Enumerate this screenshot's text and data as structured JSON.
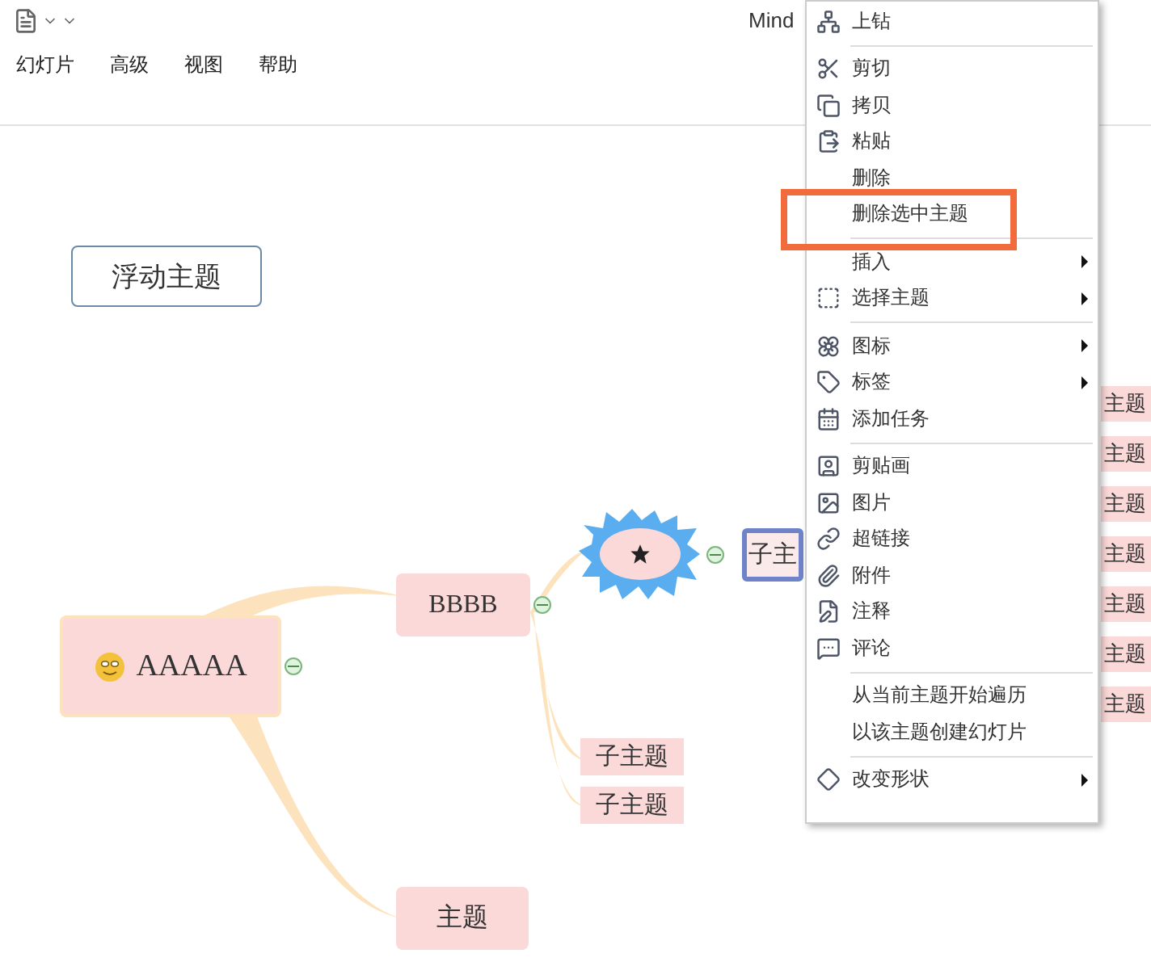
{
  "toolbar": {
    "title": "Mind",
    "ribbon_tabs": [
      "幻灯片",
      "高级",
      "视图",
      "帮助"
    ]
  },
  "canvas": {
    "floating_topic": {
      "text": "浮动主题"
    },
    "topics": [
      {
        "kind": "central",
        "text": "AAAAA",
        "selected": false
      },
      {
        "kind": "main",
        "text": "BBBB",
        "selected": false
      },
      {
        "kind": "main",
        "text": "主题",
        "selected": false
      },
      {
        "kind": "cloud",
        "selected": false
      },
      {
        "kind": "sub",
        "text": "子主",
        "selected": true
      },
      {
        "kind": "sub",
        "text": "子主题",
        "selected": false
      },
      {
        "kind": "sub",
        "text": "子主题",
        "selected": false
      },
      {
        "kind": "edge",
        "text": "主题",
        "selected": false
      },
      {
        "kind": "edge",
        "text": "主题",
        "selected": false
      },
      {
        "kind": "edge",
        "text": "主题",
        "selected": false
      },
      {
        "kind": "edge",
        "text": "主题",
        "selected": false
      },
      {
        "kind": "edge",
        "text": "主题",
        "selected": false
      },
      {
        "kind": "edge",
        "text": "主题",
        "selected": false
      },
      {
        "kind": "edge",
        "text": "主题",
        "selected": false
      }
    ]
  },
  "context_menu": {
    "items": [
      {
        "kind": "item",
        "label": "上钻",
        "submenu": false
      },
      {
        "kind": "separator"
      },
      {
        "kind": "item",
        "label": "剪切",
        "submenu": false
      },
      {
        "kind": "item",
        "label": "拷贝",
        "submenu": false
      },
      {
        "kind": "item",
        "label": "粘贴",
        "submenu": false
      },
      {
        "kind": "item",
        "label": "删除",
        "submenu": false
      },
      {
        "kind": "item",
        "label": "删除选中主题",
        "submenu": false,
        "highlighted": true
      },
      {
        "kind": "separator"
      },
      {
        "kind": "item",
        "label": "插入",
        "submenu": true
      },
      {
        "kind": "item",
        "label": "选择主题",
        "submenu": true
      },
      {
        "kind": "separator"
      },
      {
        "kind": "item",
        "label": "图标",
        "submenu": true
      },
      {
        "kind": "item",
        "label": "标签",
        "submenu": true
      },
      {
        "kind": "item",
        "label": "添加任务",
        "submenu": false
      },
      {
        "kind": "separator"
      },
      {
        "kind": "item",
        "label": "剪贴画",
        "submenu": false
      },
      {
        "kind": "item",
        "label": "图片",
        "submenu": false
      },
      {
        "kind": "item",
        "label": "超链接",
        "submenu": false
      },
      {
        "kind": "item",
        "label": "附件",
        "submenu": false
      },
      {
        "kind": "item",
        "label": "注释",
        "submenu": false
      },
      {
        "kind": "item",
        "label": "评论",
        "submenu": false
      },
      {
        "kind": "separator"
      },
      {
        "kind": "item",
        "label": "从当前主题开始遍历",
        "submenu": false
      },
      {
        "kind": "item",
        "label": "以该主题创建幻灯片",
        "submenu": false
      },
      {
        "kind": "separator"
      },
      {
        "kind": "item",
        "label": "改变形状",
        "submenu": true
      }
    ]
  }
}
